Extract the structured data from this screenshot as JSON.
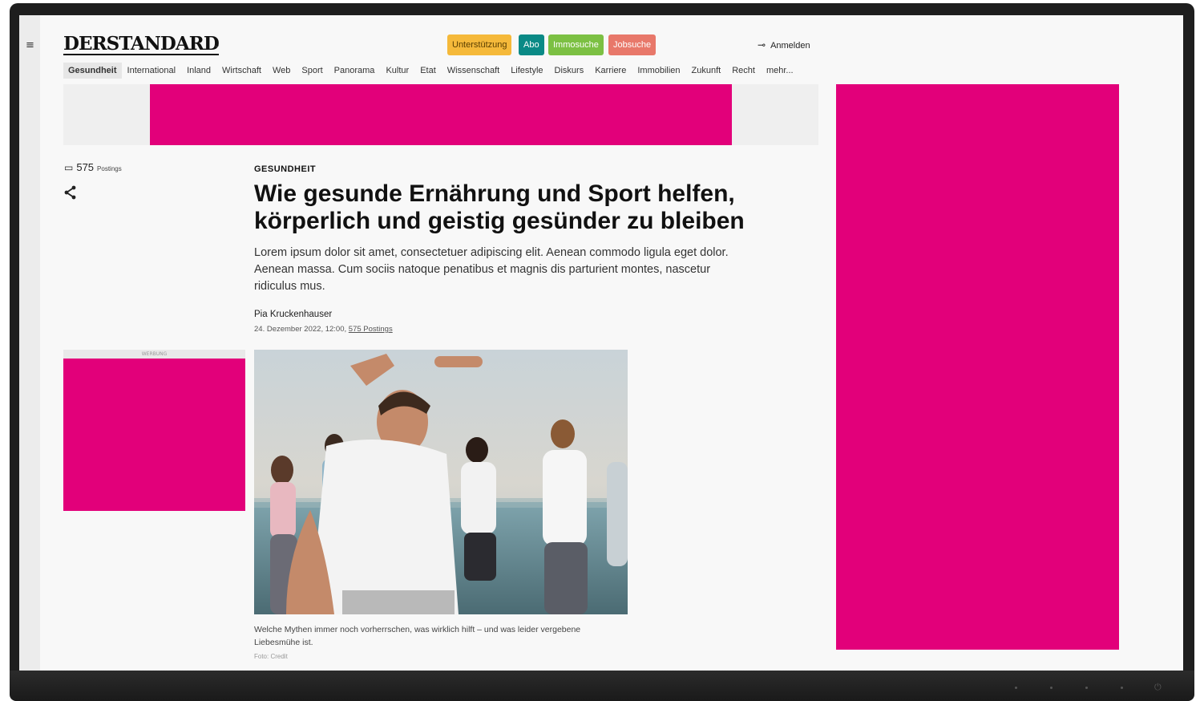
{
  "header": {
    "logo": "DERSTANDARD",
    "buttons": {
      "support": "Unterstützung",
      "abo": "Abo",
      "immo": "Immosuche",
      "job": "Jobsuche"
    },
    "login": "Anmelden"
  },
  "nav": {
    "items": [
      "Gesundheit",
      "International",
      "Inland",
      "Wirtschaft",
      "Web",
      "Sport",
      "Panorama",
      "Kultur",
      "Etat",
      "Wissenschaft",
      "Lifestyle",
      "Diskurs",
      "Karriere",
      "Immobilien",
      "Zukunft",
      "Recht",
      "mehr..."
    ]
  },
  "sidebar": {
    "postings_count": "575",
    "postings_label": "Postings"
  },
  "ads": {
    "left_label": "WERBUNG"
  },
  "article": {
    "kicker": "GESUNDHEIT",
    "headline": "Wie gesunde Ernährung und Sport helfen, körperlich und geistig gesünder zu bleiben",
    "lede": "Lorem ipsum dolor sit amet, consectetuer adipiscing elit. Aenean commodo ligula eget dolor. Aenean massa. Cum sociis natoque penatibus et magnis dis parturient montes, nascetur ridiculus mus.",
    "author": "Pia Kruckenhauser",
    "date": "24. Dezember 2022, 12:00,",
    "postings_link": "575 Postings",
    "caption": "Welche Mythen immer noch vorherrschen, was wirklich hilft – und was leider vergebene Liebesmühe ist.",
    "credit": "Foto: Credit"
  },
  "colors": {
    "ad_magenta": "#e2007a",
    "support": "#f5b93a",
    "abo": "#0a8a86",
    "immo": "#7cc043",
    "job": "#e8786a"
  }
}
